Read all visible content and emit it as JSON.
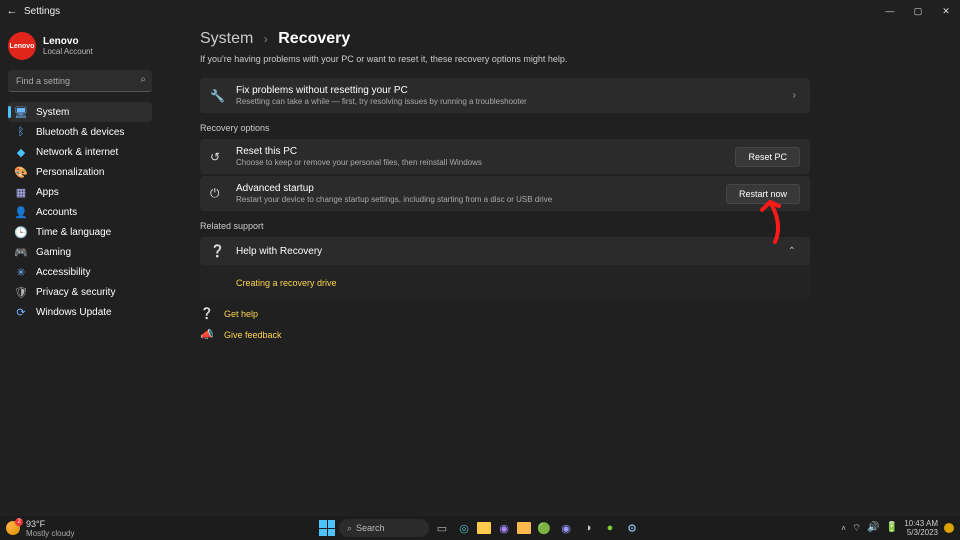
{
  "title": "Settings",
  "profile": {
    "name": "Lenovo",
    "subtitle": "Local Account",
    "avatar_text": "Lenovo"
  },
  "search": {
    "placeholder": "Find a setting"
  },
  "nav": [
    {
      "icon": "🖥",
      "label": "System",
      "color": "#6fb7ff",
      "active": true
    },
    {
      "icon": "ᛒ",
      "label": "Bluetooth & devices",
      "color": "#6fb7ff"
    },
    {
      "icon": "◆",
      "label": "Network & internet",
      "color": "#4cc2ff"
    },
    {
      "icon": "🎨",
      "label": "Personalization",
      "color": "#d88bd8"
    },
    {
      "icon": "▦",
      "label": "Apps",
      "color": "#b8b8ff"
    },
    {
      "icon": "👤",
      "label": "Accounts",
      "color": "#e0a060"
    },
    {
      "icon": "🕒",
      "label": "Time & language",
      "color": "#b8b8b8"
    },
    {
      "icon": "🎮",
      "label": "Gaming",
      "color": "#b8b8b8"
    },
    {
      "icon": "✳",
      "label": "Accessibility",
      "color": "#6fb7ff"
    },
    {
      "icon": "🛡",
      "label": "Privacy & security",
      "color": "#b8b8b8"
    },
    {
      "icon": "⟳",
      "label": "Windows Update",
      "color": "#6fb7ff"
    }
  ],
  "breadcrumb": {
    "parent": "System",
    "current": "Recovery"
  },
  "page_description": "If you're having problems with your PC or want to reset it, these recovery options might help.",
  "top_card": {
    "icon": "🔧",
    "title": "Fix problems without resetting your PC",
    "subtitle": "Resetting can take a while — first, try resolving issues by running a troubleshooter"
  },
  "section_recovery": "Recovery options",
  "reset_card": {
    "icon": "↺",
    "title": "Reset this PC",
    "subtitle": "Choose to keep or remove your personal files, then reinstall Windows",
    "button": "Reset PC"
  },
  "advanced_card": {
    "icon": "⏻",
    "title": "Advanced startup",
    "subtitle": "Restart your device to change startup settings, including starting from a disc or USB drive",
    "button": "Restart now"
  },
  "section_related": "Related support",
  "help_card": {
    "icon": "❔",
    "title": "Help with Recovery"
  },
  "help_link": "Creating a recovery drive",
  "footer_links": {
    "get_help": "Get help",
    "give_feedback": "Give feedback"
  },
  "taskbar": {
    "weather_temp": "93°F",
    "weather_cond": "Mostly cloudy",
    "search": "Search",
    "time": "10:43 AM",
    "date": "5/3/2023"
  }
}
